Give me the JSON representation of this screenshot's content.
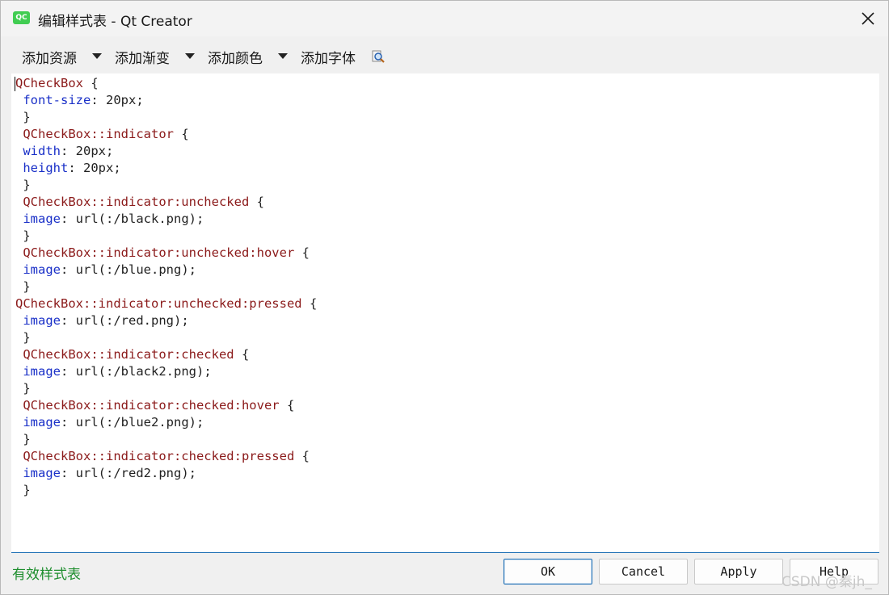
{
  "window": {
    "title": "编辑样式表 - Qt Creator",
    "app_icon_text": "QC"
  },
  "toolbar": {
    "add_resource": "添加资源",
    "add_gradient": "添加渐变",
    "add_color": "添加颜色",
    "add_font": "添加字体"
  },
  "editor": {
    "lines": [
      [
        {
          "t": "QCheckBox",
          "c": "sel"
        },
        {
          "t": " {",
          "c": ""
        }
      ],
      [
        {
          "t": " ",
          "c": ""
        },
        {
          "t": "font-size",
          "c": "prop"
        },
        {
          "t": ": 20px;",
          "c": ""
        }
      ],
      [
        {
          "t": " }",
          "c": ""
        }
      ],
      [
        {
          "t": " ",
          "c": ""
        },
        {
          "t": "QCheckBox::indicator",
          "c": "sel"
        },
        {
          "t": " {",
          "c": ""
        }
      ],
      [
        {
          "t": " ",
          "c": ""
        },
        {
          "t": "width",
          "c": "prop"
        },
        {
          "t": ": 20px;",
          "c": ""
        }
      ],
      [
        {
          "t": " ",
          "c": ""
        },
        {
          "t": "height",
          "c": "prop"
        },
        {
          "t": ": 20px;",
          "c": ""
        }
      ],
      [
        {
          "t": " }",
          "c": ""
        }
      ],
      [
        {
          "t": " ",
          "c": ""
        },
        {
          "t": "QCheckBox::indicator:unchecked",
          "c": "sel"
        },
        {
          "t": " {",
          "c": ""
        }
      ],
      [
        {
          "t": " ",
          "c": ""
        },
        {
          "t": "image",
          "c": "prop"
        },
        {
          "t": ": url(:/black.png);",
          "c": ""
        }
      ],
      [
        {
          "t": " }",
          "c": ""
        }
      ],
      [
        {
          "t": " ",
          "c": ""
        },
        {
          "t": "QCheckBox::indicator:unchecked:hover",
          "c": "sel"
        },
        {
          "t": " {",
          "c": ""
        }
      ],
      [
        {
          "t": " ",
          "c": ""
        },
        {
          "t": "image",
          "c": "prop"
        },
        {
          "t": ": url(:/blue.png);",
          "c": ""
        }
      ],
      [
        {
          "t": " }",
          "c": ""
        }
      ],
      [
        {
          "t": "QCheckBox::indicator:unchecked:pressed",
          "c": "sel"
        },
        {
          "t": " {",
          "c": ""
        }
      ],
      [
        {
          "t": " ",
          "c": ""
        },
        {
          "t": "image",
          "c": "prop"
        },
        {
          "t": ": url(:/red.png);",
          "c": ""
        }
      ],
      [
        {
          "t": " }",
          "c": ""
        }
      ],
      [
        {
          "t": " ",
          "c": ""
        },
        {
          "t": "QCheckBox::indicator:checked",
          "c": "sel"
        },
        {
          "t": " {",
          "c": ""
        }
      ],
      [
        {
          "t": " ",
          "c": ""
        },
        {
          "t": "image",
          "c": "prop"
        },
        {
          "t": ": url(:/black2.png);",
          "c": ""
        }
      ],
      [
        {
          "t": " }",
          "c": ""
        }
      ],
      [
        {
          "t": " ",
          "c": ""
        },
        {
          "t": "QCheckBox::indicator:checked:hover",
          "c": "sel"
        },
        {
          "t": " {",
          "c": ""
        }
      ],
      [
        {
          "t": " ",
          "c": ""
        },
        {
          "t": "image",
          "c": "prop"
        },
        {
          "t": ": url(:/blue2.png);",
          "c": ""
        }
      ],
      [
        {
          "t": " }",
          "c": ""
        }
      ],
      [
        {
          "t": " ",
          "c": ""
        },
        {
          "t": "QCheckBox::indicator:checked:pressed",
          "c": "sel"
        },
        {
          "t": " {",
          "c": ""
        }
      ],
      [
        {
          "t": " ",
          "c": ""
        },
        {
          "t": "image",
          "c": "prop"
        },
        {
          "t": ": url(:/red2.png);",
          "c": ""
        }
      ],
      [
        {
          "t": " }",
          "c": ""
        }
      ]
    ]
  },
  "status": {
    "valid_text": "有效样式表",
    "watermark": "CSDN @秦jh_"
  },
  "buttons": {
    "ok": "OK",
    "cancel": "Cancel",
    "apply": "Apply",
    "help": "Help"
  },
  "colors": {
    "selector": "#8b1a1a",
    "property": "#1a30c8",
    "valid": "#1e8e2e",
    "focus_border": "#1e6fb5"
  },
  "icons": [
    "qt-creator-icon",
    "close-icon",
    "dropdown-arrow-icon",
    "font-search-icon"
  ]
}
